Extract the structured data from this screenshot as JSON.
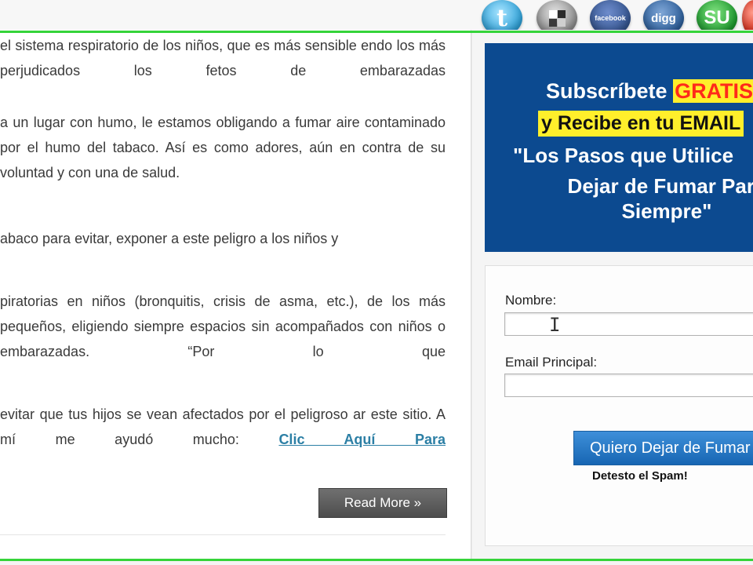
{
  "social": {
    "twitter": "twitter-icon",
    "delicious": "delicious-icon",
    "facebook_text": "facebook",
    "digg_text": "digg",
    "stumbleupon_text": "SU",
    "extra": "social-icon",
    "twitter_glyph": "t"
  },
  "article": {
    "paragraphs": [
      "el sistema respiratorio de los niños, que es más sensible endo los más perjudicados los fetos de embarazadas",
      "a un lugar con humo, le estamos obligando a fumar aire contaminado por el humo del tabaco. Así es como adores, aún en contra de su voluntad y con una de salud.",
      "abaco para evitar, exponer a este peligro a los niños y",
      "piratorias en niños (bronquitis, crisis de asma, etc.), de los más pequeños, eligiendo siempre espacios sin acompañados con niños o embarazadas. “Por lo que",
      "evitar que tus hijos se vean afectados por el peligroso ar este sitio. A mí me ayudó mucho:"
    ],
    "link_text": "Clic Aquí Para",
    "read_more": "Read More »"
  },
  "promo": {
    "line1_prefix": "Subscríbete ",
    "line1_highlight": "GRATIS",
    "line2": "y Recibe en tu EMAIL",
    "line3": "\"Los Pasos que Utilice",
    "line4a": "Dejar de Fumar Para",
    "line4b": "Siempre\""
  },
  "form": {
    "name_label": "Nombre:",
    "name_value": "",
    "email_label": "Email Principal:",
    "email_value": "",
    "submit_label": "Quiero Dejar de Fumar",
    "spam_note": "Detesto el Spam!"
  },
  "colors": {
    "accent_green": "#35d43a",
    "promo_blue": "#0c4a90",
    "highlight_yellow": "#ffef2b",
    "highlight_red": "#ff2a1a",
    "link_blue": "#2c7fa5"
  }
}
